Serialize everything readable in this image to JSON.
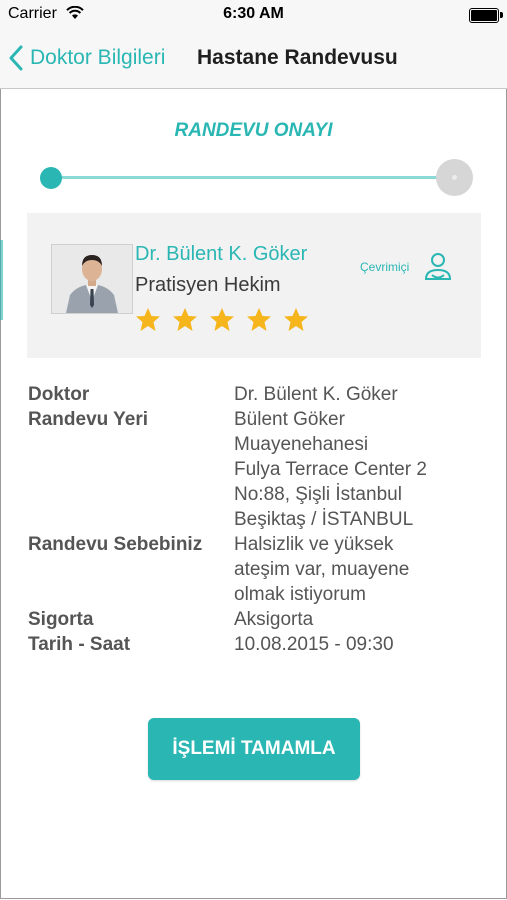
{
  "status_bar": {
    "carrier": "Carrier",
    "time": "6:30 AM"
  },
  "nav": {
    "back_label": "Doktor Bilgileri",
    "title": "Hastane Randevusu"
  },
  "step": {
    "title": "RANDEVU ONAYI"
  },
  "doctor_card": {
    "name": "Dr. Bülent K. Göker",
    "specialty": "Pratisyen Hekim",
    "rating_stars": 5,
    "online_label": "Çevrimiçi"
  },
  "details": [
    {
      "label": "Doktor",
      "value": "Dr. Bülent K. Göker"
    },
    {
      "label": "Randevu Yeri",
      "value": "Bülent Göker\nMuayenehanesi\nFulya Terrace Center 2\nNo:88, Şişli İstanbul\nBeşiktaş / İSTANBUL"
    },
    {
      "label": "Randevu Sebebiniz",
      "value": "Halsizlik ve yüksek\nateşim var, muayene\nolmak istiyorum"
    },
    {
      "label": "Sigorta",
      "value": "Aksigorta"
    },
    {
      "label": "Tarih - Saat",
      "value": "10.08.2015 - 09:30"
    }
  ],
  "actions": {
    "complete_label": "İŞLEMİ TAMAMLA"
  },
  "colors": {
    "accent": "#2ab7b4",
    "star": "#f5b51b",
    "card_bg": "#f2f2f2"
  },
  "icons": [
    "wifi-icon",
    "battery-icon",
    "back-chevron-icon",
    "star-icon",
    "online-user-icon"
  ]
}
